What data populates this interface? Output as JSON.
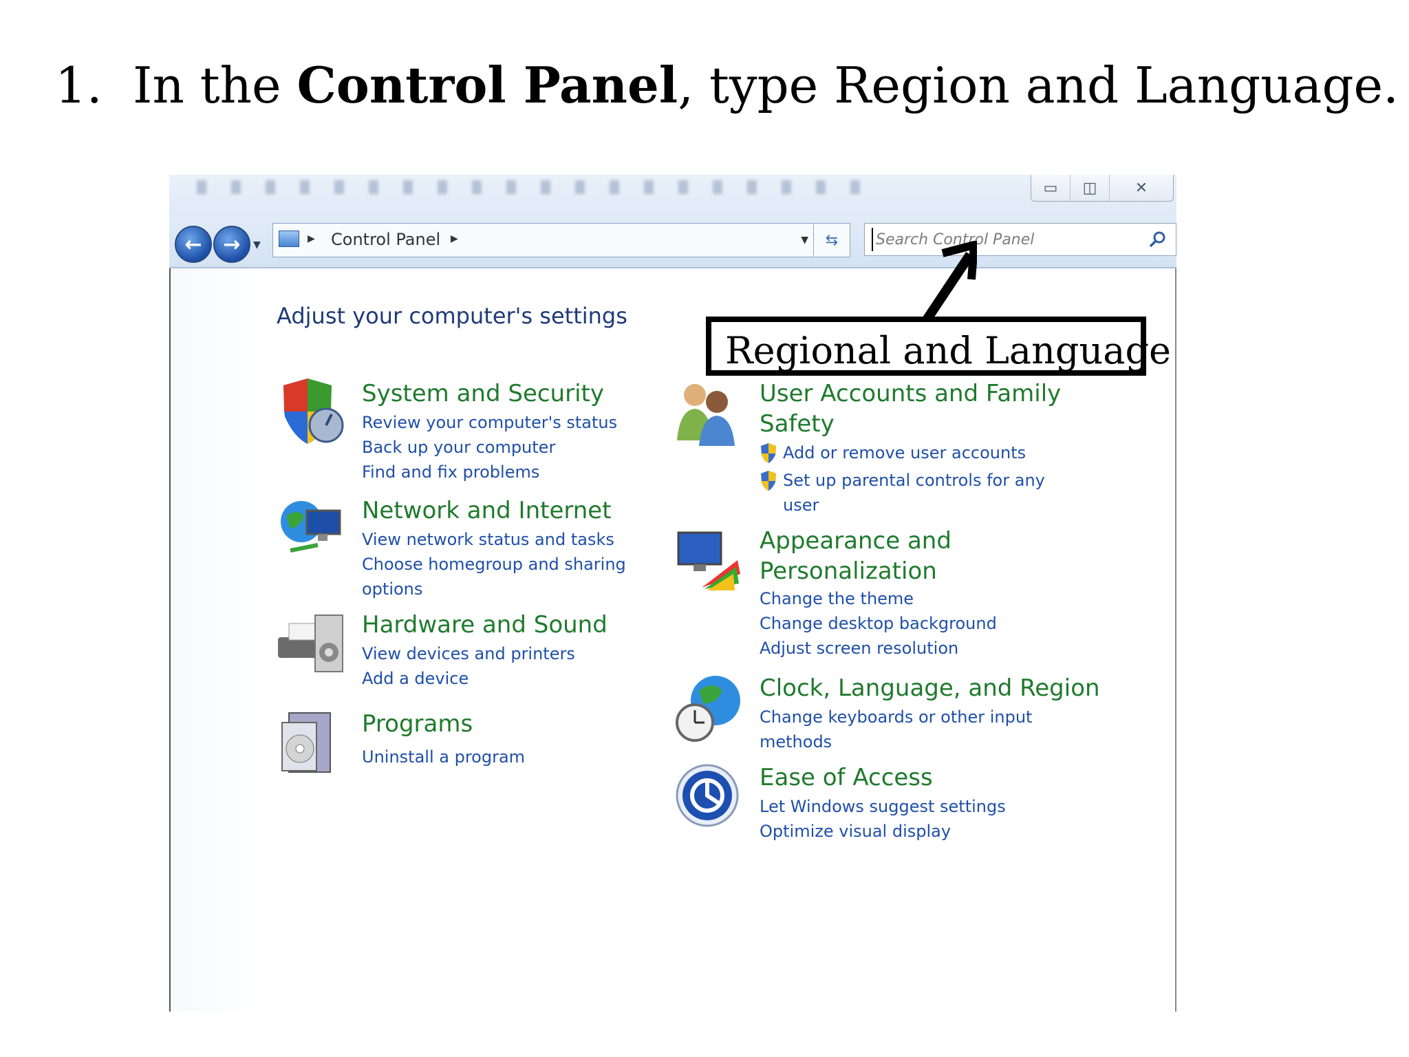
{
  "instruction": {
    "number": "1.",
    "prefix": "In the ",
    "bold": "Control Panel",
    "suffix": ", type Region and Language."
  },
  "address_bar": {
    "breadcrumb": "Control Panel"
  },
  "search": {
    "placeholder": "Search Control Panel"
  },
  "content": {
    "heading": "Adjust your computer's settings"
  },
  "categories_left": [
    {
      "title": "System and Security",
      "links": [
        "Review your computer's status",
        "Back up your computer",
        "Find and fix problems"
      ]
    },
    {
      "title": "Network and Internet",
      "links": [
        "View network status and tasks",
        "Choose homegroup and sharing",
        "options"
      ]
    },
    {
      "title": "Hardware and Sound",
      "links": [
        "View devices and printers",
        "Add a device"
      ]
    },
    {
      "title": "Programs",
      "links": [
        "Uninstall a program"
      ]
    }
  ],
  "categories_right": [
    {
      "title_lines": [
        "User Accounts and Family",
        "Safety"
      ],
      "links": [
        "Add or remove user accounts",
        "Set up parental controls for any",
        "user"
      ]
    },
    {
      "title_lines": [
        "Appearance and",
        "Personalization"
      ],
      "links": [
        "Change the theme",
        "Change desktop background",
        "Adjust screen resolution"
      ]
    },
    {
      "title": "Clock, Language, and Region",
      "links": [
        "Change keyboards or other input",
        "methods"
      ]
    },
    {
      "title": "Ease of Access",
      "links": [
        "Let Windows suggest settings",
        "Optimize visual display"
      ]
    }
  ],
  "callout": {
    "text": "Regional  and Language"
  },
  "icons": {
    "back": "back-arrow-icon",
    "forward": "forward-arrow-icon",
    "search": "magnifier-icon",
    "refresh": "refresh-icon",
    "uac": "uac-shield-icon"
  }
}
